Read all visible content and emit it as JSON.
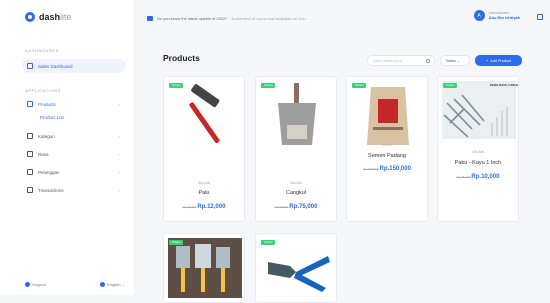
{
  "app": {
    "logo_main": "dash",
    "logo_lite": "lite"
  },
  "sidebar": {
    "section1": "DASHBOARDS",
    "dashboard_label": "Sales Dashboard",
    "section2": "APPLICATIONS",
    "items": [
      {
        "label": "Products"
      },
      {
        "label": "Kategori"
      },
      {
        "label": "Rasa"
      },
      {
        "label": "Pelanggan"
      },
      {
        "label": "Transactions"
      }
    ],
    "sub_item": "Product List",
    "footer_left": "Support",
    "footer_right": "English"
  },
  "topbar": {
    "announcement": "Do you know the latest update of 2022?",
    "announcement_link": "A overview of our is now available on You...",
    "user_role": "Administrator",
    "user_name": "Abu Bin Ishtiyak"
  },
  "page": {
    "title": "Products",
    "search_placeholder": "Quick search by id",
    "status_label": "Status",
    "add_label": "Add Product"
  },
  "products": [
    {
      "badge": "Terbaru",
      "category": "Alat-Alat",
      "name": "Palu",
      "old_price": "Rp.15.000",
      "price": "Rp.12,000"
    },
    {
      "badge": "Terbaru",
      "category": "Alat-Alat",
      "name": "Cangkul",
      "old_price": "Rp.80.000",
      "price": "Rp.75,000"
    },
    {
      "badge": "Terbaru",
      "category": "Semen",
      "name": "Semen Padang",
      "old_price": "Rp.155.000",
      "price": "Rp.150,000"
    },
    {
      "badge": "Terbaru",
      "category": "Alat-Alat",
      "name": "Paku - Kayu 1 Inch",
      "old_price": "Rp.15.000",
      "price": "Rp.10,000",
      "image_text": "PAKU KAYU 1 INCH"
    },
    {
      "badge": "Terbaru"
    },
    {
      "badge": "Terbaru"
    }
  ]
}
